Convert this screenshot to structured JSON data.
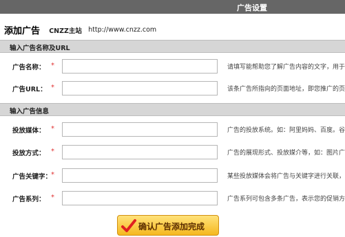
{
  "header": {
    "title": "广告设置"
  },
  "page": {
    "title": "添加广告",
    "site_name": "CNZZ主站",
    "site_url": "http://www.cnzz.com"
  },
  "sections": {
    "name_url": "输入广告名称及URL",
    "info": "输入广告信息"
  },
  "fields": {
    "ad_name": {
      "label": "广告名称：",
      "required": "*",
      "value": "",
      "hint": "请填写能帮助您了解广告内容的文字，用于"
    },
    "ad_url": {
      "label": "广告URL：",
      "required": "*",
      "value": "",
      "hint": "该条广告所指向的页面地址，即您推广的页"
    },
    "media": {
      "label": "投放媒体：",
      "required": "*",
      "value": "",
      "hint": "广告的投放系统。如：阿里妈妈、百度。谷"
    },
    "method": {
      "label": "投放方式：",
      "required": "*",
      "value": "",
      "hint": "广告的展现形式、投放媒介等，如：图片广"
    },
    "keyword": {
      "label": "广告关键字：",
      "required": "*",
      "value": "",
      "hint": "某些投放媒体会将广告与关键字进行关联，"
    },
    "series": {
      "label": "广告系列：",
      "required": "*",
      "value": "",
      "hint": "广告系列可包含多条广告，表示您的促销方"
    }
  },
  "submit": {
    "label": "确认广告添加完成",
    "icon": "checkmark-icon"
  },
  "colors": {
    "topbar": "#666666",
    "section": "#d6d6d6",
    "required": "#e03030",
    "button": "#f5b81f",
    "check": "#e02020"
  }
}
